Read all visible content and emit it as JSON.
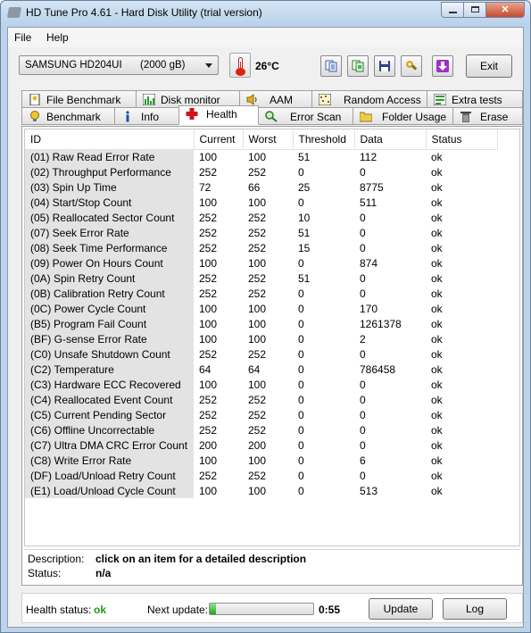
{
  "window": {
    "title": "HD Tune Pro 4.61 - Hard Disk Utility (trial version)"
  },
  "menu": {
    "file": "File",
    "help": "Help"
  },
  "toolbar": {
    "drive_name": "SAMSUNG HD204UI",
    "drive_size": "(2000 gB)",
    "temperature": "26°C",
    "exit_label": "Exit"
  },
  "tabs_top": [
    {
      "label": "File Benchmark",
      "icon": "file-benchmark-icon"
    },
    {
      "label": "Disk monitor",
      "icon": "disk-monitor-icon"
    },
    {
      "label": "AAM",
      "icon": "speaker-icon"
    },
    {
      "label": "Random Access",
      "icon": "random-access-icon"
    },
    {
      "label": "Extra tests",
      "icon": "extra-tests-icon"
    }
  ],
  "tabs_bottom": [
    {
      "label": "Benchmark",
      "icon": "lightbulb-icon"
    },
    {
      "label": "Info",
      "icon": "info-icon"
    },
    {
      "label": "Health",
      "icon": "health-cross-icon",
      "active": true
    },
    {
      "label": "Error Scan",
      "icon": "magnifier-icon"
    },
    {
      "label": "Folder Usage",
      "icon": "folder-icon"
    },
    {
      "label": "Erase",
      "icon": "trash-icon"
    }
  ],
  "table": {
    "headers": [
      "ID",
      "Current",
      "Worst",
      "Threshold",
      "Data",
      "Status"
    ],
    "rows": [
      [
        "(01) Raw Read Error Rate",
        "100",
        "100",
        "51",
        "112",
        "ok"
      ],
      [
        "(02) Throughput Performance",
        "252",
        "252",
        "0",
        "0",
        "ok"
      ],
      [
        "(03) Spin Up Time",
        "72",
        "66",
        "25",
        "8775",
        "ok"
      ],
      [
        "(04) Start/Stop Count",
        "100",
        "100",
        "0",
        "511",
        "ok"
      ],
      [
        "(05) Reallocated Sector Count",
        "252",
        "252",
        "10",
        "0",
        "ok"
      ],
      [
        "(07) Seek Error Rate",
        "252",
        "252",
        "51",
        "0",
        "ok"
      ],
      [
        "(08) Seek Time Performance",
        "252",
        "252",
        "15",
        "0",
        "ok"
      ],
      [
        "(09) Power On Hours Count",
        "100",
        "100",
        "0",
        "874",
        "ok"
      ],
      [
        "(0A) Spin Retry Count",
        "252",
        "252",
        "51",
        "0",
        "ok"
      ],
      [
        "(0B) Calibration Retry Count",
        "252",
        "252",
        "0",
        "0",
        "ok"
      ],
      [
        "(0C) Power Cycle Count",
        "100",
        "100",
        "0",
        "170",
        "ok"
      ],
      [
        "(B5) Program Fail Count",
        "100",
        "100",
        "0",
        "1261378",
        "ok"
      ],
      [
        "(BF) G-sense Error Rate",
        "100",
        "100",
        "0",
        "2",
        "ok"
      ],
      [
        "(C0) Unsafe Shutdown Count",
        "252",
        "252",
        "0",
        "0",
        "ok"
      ],
      [
        "(C2) Temperature",
        "64",
        "64",
        "0",
        "786458",
        "ok"
      ],
      [
        "(C3) Hardware ECC Recovered",
        "100",
        "100",
        "0",
        "0",
        "ok"
      ],
      [
        "(C4) Reallocated Event Count",
        "252",
        "252",
        "0",
        "0",
        "ok"
      ],
      [
        "(C5) Current Pending Sector",
        "252",
        "252",
        "0",
        "0",
        "ok"
      ],
      [
        "(C6) Offline Uncorrectable",
        "252",
        "252",
        "0",
        "0",
        "ok"
      ],
      [
        "(C7) Ultra DMA CRC Error Count",
        "200",
        "200",
        "0",
        "0",
        "ok"
      ],
      [
        "(C8) Write Error Rate",
        "100",
        "100",
        "0",
        "6",
        "ok"
      ],
      [
        "(DF) Load/Unload Retry Count",
        "252",
        "252",
        "0",
        "0",
        "ok"
      ],
      [
        "(E1) Load/Unload Cycle Count",
        "100",
        "100",
        "0",
        "513",
        "ok"
      ]
    ]
  },
  "description": {
    "label": "Description:",
    "value": "click on an item for a detailed description",
    "status_label": "Status:",
    "status_value": "n/a"
  },
  "footer": {
    "health_label": "Health status:",
    "health_value": "ok",
    "next_update_label": "Next update:",
    "progress_percent": 6,
    "countdown": "0:55",
    "update_label": "Update",
    "log_label": "Log"
  },
  "colors": {
    "ok_green": "#1e9a1e",
    "id_column": "#e3e3e3",
    "health_red": "#d0121a"
  }
}
